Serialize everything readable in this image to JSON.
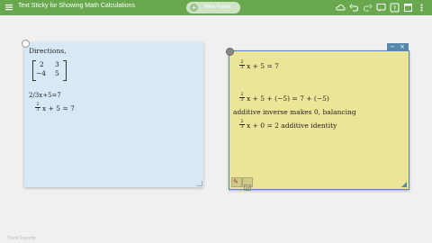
{
  "app": {
    "title": "Text Sticky for Showing Math Calculations",
    "new_panel_label": "New Panel",
    "footer": "Track Favorite"
  },
  "colors": {
    "topbar": "#6aa84f",
    "blue_note": "#d7e9f6",
    "yellow_note": "#ece598",
    "accent": "#5588aa"
  },
  "blue_note": {
    "directions": "Directions,",
    "matrix": [
      [
        "2",
        "3"
      ],
      [
        "−4",
        "5"
      ]
    ],
    "line1": "2/3x+5=7",
    "line2_frac": {
      "num": "2",
      "den": "3"
    },
    "line2_rest": "x + 5 = 7"
  },
  "yellow_note": {
    "line1_frac": {
      "num": "2",
      "den": "3"
    },
    "line1_rest": "x + 5 = 7",
    "line2_frac": {
      "num": "2",
      "den": "3"
    },
    "line2_rest": "x + 5 + (−5) = 7 + (−5)",
    "line3": "additive inverse makes 0, balancing",
    "line4_frac": {
      "num": "2",
      "den": "3"
    },
    "line4_rest": "x + 0 = 2  additive identity"
  },
  "icons": [
    "menu-icon",
    "cloud-icon",
    "undo-icon",
    "redo-icon",
    "chat-icon",
    "help-icon",
    "window-icon",
    "more-icon"
  ]
}
